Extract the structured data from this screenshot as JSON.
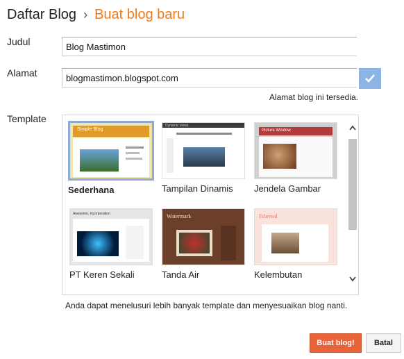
{
  "breadcrumb": {
    "parent": "Daftar Blog",
    "separator": "›",
    "current": "Buat blog baru"
  },
  "form": {
    "title_label": "Judul",
    "title_value": "Blog Mastimon",
    "address_label": "Alamat",
    "address_value": "blogmastimon.blogspot.com",
    "address_status": "Alamat blog ini tersedia.",
    "template_label": "Template"
  },
  "templates": [
    {
      "name": "Sederhana",
      "selected": true,
      "thumb_title": "Simple Blog"
    },
    {
      "name": "Tampilan Dinamis",
      "selected": false,
      "thumb_title": "Dynamic views"
    },
    {
      "name": "Jendela Gambar",
      "selected": false,
      "thumb_title": "Picture Window"
    },
    {
      "name": "PT Keren Sekali",
      "selected": false,
      "thumb_title": "Awesome, Incorporation"
    },
    {
      "name": "Tanda Air",
      "selected": false,
      "thumb_title": "Watermark"
    },
    {
      "name": "Kelembutan",
      "selected": false,
      "thumb_title": "Ethereal"
    }
  ],
  "hint": "Anda dapat menelusuri lebih banyak template dan menyesuaikan blog nanti.",
  "actions": {
    "create": "Buat blog!",
    "cancel": "Batal"
  },
  "colors": {
    "accent": "#ec7c1b",
    "primary_button": "#e9643a",
    "check_button": "#8cb4e4",
    "selected_border": "#8aa9d4"
  },
  "icons": {
    "check": "check-icon",
    "scroll_up": "chevron-up-icon",
    "scroll_down": "chevron-down-icon"
  }
}
